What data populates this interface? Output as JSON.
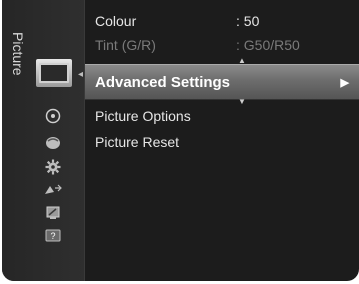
{
  "menu": {
    "title": "Picture",
    "items": [
      {
        "label": "Colour",
        "value": ": 50"
      },
      {
        "label": "Tint (G/R)",
        "value": ": G50/R50"
      },
      {
        "label": "Advanced Settings",
        "value": ""
      },
      {
        "label": "Picture Options",
        "value": ""
      },
      {
        "label": "Picture Reset",
        "value": ""
      }
    ],
    "selected_arrow": "▶"
  },
  "categories": [
    {
      "icon": "picture-icon"
    },
    {
      "icon": "sound-icon"
    },
    {
      "icon": "channel-icon"
    },
    {
      "icon": "setup-icon"
    },
    {
      "icon": "input-icon"
    },
    {
      "icon": "application-icon"
    },
    {
      "icon": "support-icon"
    }
  ]
}
